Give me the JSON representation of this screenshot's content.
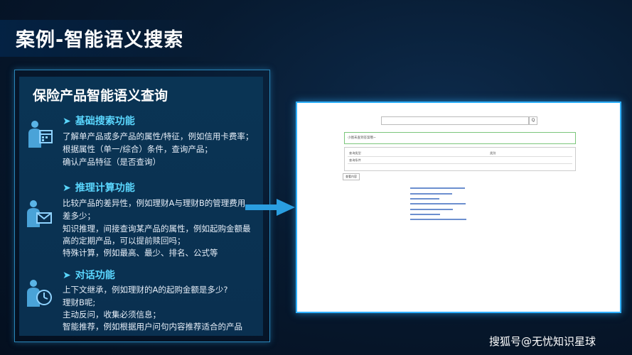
{
  "slide": {
    "title": "案例-智能语义搜索",
    "panel_title": "保险产品智能语义查询",
    "sections": [
      {
        "heading": "基础搜索功能",
        "icon": "business-person-calendar-icon",
        "lines": [
          "了解单产品或多产品的属性/特征，例如信用卡费率；",
          "根据属性（单一/综合）条件，查询产品；",
          "确认产品特征（是否查询）"
        ]
      },
      {
        "heading": "推理计算功能",
        "icon": "business-person-mail-icon",
        "lines": [
          "比较产品的差异性，例如理财A与理财B的管理费用",
          "差多少；",
          "知识推理，间接查询某产品的属性，例如起购金额最",
          "高的定期产品，可以提前赎回吗；",
          "特殊计算，例如最高、最少、排名、公式等"
        ]
      },
      {
        "heading": "对话功能",
        "icon": "business-person-clock-icon",
        "lines": [
          "上下文继承，例如理财的A的起购金额是多少?",
          "理财B呢;",
          "主动反问，收集必须信息；",
          "智能推荐，例如根据用户问句内容推荐适合的产品"
        ]
      }
    ],
    "watermark": "搜狐号@无忧知识星球"
  },
  "screenshot": {
    "search_button": "Q",
    "green_box_text": "小图未查到答案哦~",
    "table": [
      [
        "查询类型",
        "类别"
      ],
      [
        "查询条件",
        ""
      ]
    ],
    "send_button": "查看内容"
  },
  "colors": {
    "accent": "#5ad7ff",
    "frame": "#2fb0ff",
    "arrow": "#2a9ee0"
  }
}
